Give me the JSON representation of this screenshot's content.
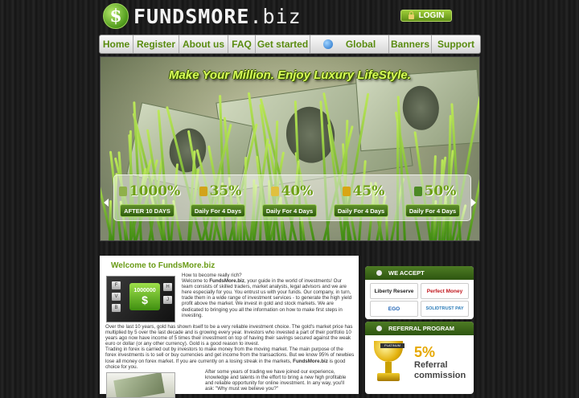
{
  "header": {
    "logo_symbol": "$",
    "logo_bold": "FUNDSMORE",
    "logo_suffix": ".biz",
    "login_label": "LOGIN"
  },
  "nav": [
    {
      "label": "Home",
      "name": "nav-home"
    },
    {
      "label": "Register",
      "name": "nav-register"
    },
    {
      "label": "About us",
      "name": "nav-about-us"
    },
    {
      "label": "FAQ",
      "name": "nav-faq"
    },
    {
      "label": "Get started",
      "name": "nav-get-started"
    },
    {
      "label": "Global",
      "name": "nav-global"
    },
    {
      "label": "Banners",
      "name": "nav-banners"
    },
    {
      "label": "Support",
      "name": "nav-support"
    }
  ],
  "banner": {
    "tagline": "Make Your Million. Enjoy Luxury LifeStyle.",
    "plans": [
      {
        "percent": "1000%",
        "button": "AFTER 10 DAYS",
        "icon": "money-bag-icon",
        "icon_color": "#8fb04a"
      },
      {
        "percent": "35%",
        "button": "Daily For 4 Days",
        "icon": "gold-box-icon",
        "icon_color": "#d2a31a"
      },
      {
        "percent": "40%",
        "button": "Daily For 4 Days",
        "icon": "coins-icon",
        "icon_color": "#e0c040"
      },
      {
        "percent": "45%",
        "button": "Daily For 4 Days",
        "icon": "gold-bars-icon",
        "icon_color": "#d9a514"
      },
      {
        "percent": "50%",
        "button": "Daily For 4 Days",
        "icon": "cash-stack-icon",
        "icon_color": "#4c8a24"
      }
    ]
  },
  "welcome": {
    "title": "Welcome to FundsMore.biz",
    "intro_question": "How to become really rich?",
    "intro_lead": "Welcome to ",
    "intro_brand": "FundsMore.biz",
    "intro_rest": ", your guide in the world of investments! Our team consists of skilled traders, market analysts, legal advisors and we are here especially for you. You entrust us with your funds. Our company, in turn, trade them in a wide range of investment services - to generate the high yield profit above the market. We invest in gold and stock markets. We are dedicated to bringing you all the information on how to make first steps in investing.",
    "body1_a": "Over the last 10 years, gold has shown itself to be a very reliable investment choice. The gold's market price has multiplied by 5 over the last decade and is growing every year. Investors who invested a part of their portfolio 10 years ago now have income of 5 times their investment on top of having their savings secured against the weak euro or dollar (or any other currency). Gold is a good reason to invest.",
    "body1_b": "Trading in forex is carried out by investors to make money from the moving market. The main purpose of the forex investments is to sell or buy currencies and get income from the transactions. But we know 95% of newbies lose all money on forex market. If you are currently on a losing streak in the markets, ",
    "body1_brand": "FundsMore.biz",
    "body1_end": " is good choice for you.",
    "body2": "After some years of trading we have joined our experience, knowledge and talents in the effort to bring a new high profitable and reliable opportunity for online investment. In any way, you'll ask: \"Why must we believe you?\"",
    "promo_key_text": "1000000",
    "promo_key_symbol": "$"
  },
  "sidebar": {
    "accept_title": "WE ACCEPT",
    "payments": [
      {
        "label": "Liberty Reserve",
        "color": "#222222"
      },
      {
        "label": "Perfect Money",
        "color": "#c0161c"
      },
      {
        "label": "EGO",
        "color": "#1e63b5"
      },
      {
        "label": "SOLIDTRUST PAY",
        "color": "#2a7bb8"
      }
    ],
    "referral_title": "REFERRAL PROGRAM",
    "referral_percent": "5%",
    "referral_text": "Referral commission",
    "trophy_plate": "PLATINUM"
  },
  "colors": {
    "accent_green": "#6a9b16",
    "nav_text": "#5a8c10",
    "tagline": "#d9ff5a"
  }
}
